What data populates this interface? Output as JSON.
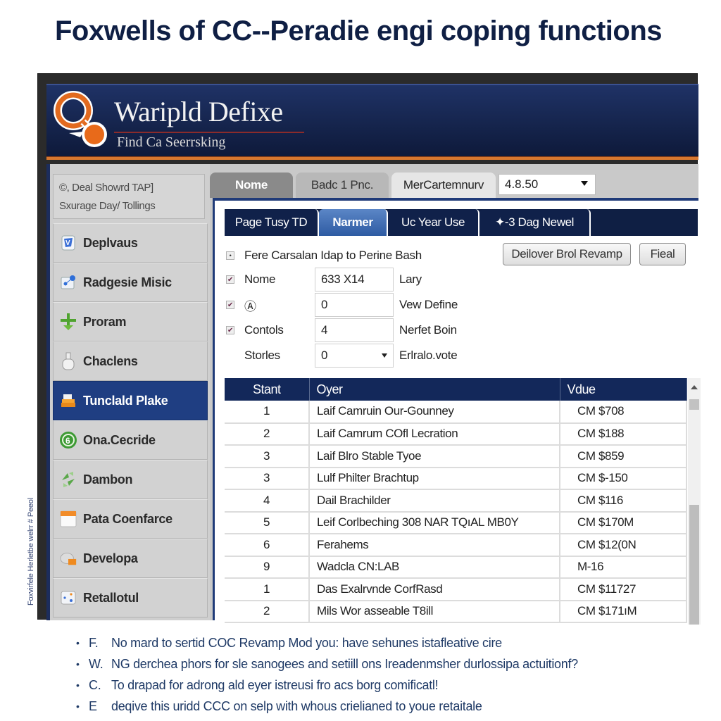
{
  "page_title": "Foxwells of CC--Peradie engi coping functions",
  "vertical_note": "Foxvirfele Herletbe welrr # Peeol",
  "app": {
    "brand_name": "Waripld Defixe",
    "tagline": "Find Ca Seerrsking",
    "colors": {
      "header_navy": "#15244c",
      "accent_orange": "#d7772f",
      "active_blue": "#1f3e82",
      "table_header": "#13285a"
    }
  },
  "sidebar": {
    "info_line1": "©, Deal Showrd TAP]",
    "info_line2": "Sxurage Day/ Tollings",
    "items": [
      {
        "label": "Deplvaus",
        "icon": "document-icon",
        "active": false
      },
      {
        "label": "Radgesie Misic",
        "icon": "diagram-icon",
        "active": false
      },
      {
        "label": "Proram",
        "icon": "plus-arrow-icon",
        "active": false
      },
      {
        "label": "Chaclens",
        "icon": "bottle-icon",
        "active": false
      },
      {
        "label": "Tunclald Plake",
        "icon": "stack-icon",
        "active": true
      },
      {
        "label": "Ona.Cecride",
        "icon": "green-badge-icon",
        "active": false
      },
      {
        "label": "Dambon",
        "icon": "recycle-icon",
        "active": false
      },
      {
        "label": "Pata Coenfarce",
        "icon": "calendar-icon",
        "active": false
      },
      {
        "label": "Developa",
        "icon": "cloud-folder-icon",
        "active": false
      },
      {
        "label": "Retallotul",
        "icon": "network-icon",
        "active": false
      }
    ]
  },
  "main": {
    "top_tabs": [
      "Nome",
      "Badc 1 Pnc.",
      "MerCartemnurv"
    ],
    "version_select": "4.8.50",
    "sub_tabs": [
      {
        "label": "Page Tusy  TD",
        "active": false
      },
      {
        "label": "Narmer",
        "active": true
      },
      {
        "label": "Uc Year Use",
        "active": false
      },
      {
        "label": "✦-3 Dag Newel",
        "active": false
      }
    ],
    "form": {
      "header_label": "Fere Carsalan Idap to Perine Bash",
      "buttons": {
        "primary": "Deilover Brol Revamp",
        "secondary": "Fieal"
      },
      "rows": [
        {
          "checked": true,
          "label": "Nome",
          "value": "633 X14",
          "description": "Lary",
          "dropdown": false
        },
        {
          "checked": true,
          "label": "Ⓐ",
          "value": "0",
          "description": "Vew Define",
          "dropdown": false
        },
        {
          "checked": true,
          "label": "Contols",
          "value": "4",
          "description": "Nerfet Boin",
          "dropdown": false
        },
        {
          "checked": false,
          "label": "Storles",
          "value": "0",
          "description": "Erlralo.vote",
          "dropdown": true
        }
      ]
    },
    "table": {
      "columns": [
        "Stant",
        "Oyer",
        "Vdue"
      ],
      "rows": [
        [
          "1",
          "Laif Camruin Our-Gounney",
          "CM $708"
        ],
        [
          "2",
          "Laif Camrum COfl Lecration",
          "CM $188"
        ],
        [
          "3",
          "Laif Blro Stable Tyoe",
          "CM $859"
        ],
        [
          "3",
          "Lulf Philter Brachtup",
          "CM $-150"
        ],
        [
          "4",
          "Dail Brachilder",
          "CM $116"
        ],
        [
          "5",
          "Leif Corlbeching 308 NAR TQıAL MB0Y",
          "CM $170M"
        ],
        [
          "6",
          "Ferahems",
          "CM $12(0N"
        ],
        [
          "9",
          "Wadcla CN:LAB",
          "M-16"
        ],
        [
          "1",
          "Das Exalrvnde CorfRasd",
          "CM $11727"
        ],
        [
          "2",
          "Mils Wor asseable T8ill",
          "CM $171ıM"
        ]
      ]
    }
  },
  "notes": [
    {
      "key": "F.",
      "text": "No mard to sertid COC Revamp Mod  you: have sehunes istafleative cire"
    },
    {
      "key": "W.",
      "text": "NG derchea phors for sle sanogees and setiill ons Ireadenmsher durlossipa actuitionf?"
    },
    {
      "key": "C.",
      "text": "To drapad for adrong ald eyer istreusi fro acs borg comificatl!"
    },
    {
      "key": "E",
      "text": "deqive this uridd CCC on selp with whous crielianed to youe retaitale"
    }
  ]
}
